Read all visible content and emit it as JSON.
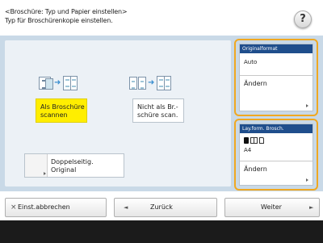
{
  "header": {
    "title": "<Broschüre: Typ und Papier einstellen>",
    "subtitle": "Typ für Broschürenkopie einstellen.",
    "help_label": "?"
  },
  "modes": [
    {
      "label_line1": "Als Broschüre",
      "label_line2": "scannen",
      "selected": true
    },
    {
      "label_line1": "Nicht als Br.-",
      "label_line2": "schüre scan.",
      "selected": false
    }
  ],
  "duplex": {
    "label_line1": "Doppelseitig.",
    "label_line2": "Original"
  },
  "original_format": {
    "title": "Originalformat",
    "value": "Auto",
    "change_label": "Ändern"
  },
  "layout_paper": {
    "title": "Lay.form. Brosch.",
    "paper": "A4",
    "change_label": "Ändern"
  },
  "bottom": {
    "cancel_icon": "×",
    "cancel_label": "Einst.abbrechen",
    "back_icon": "◄",
    "back_label": "Zurück",
    "next_label": "Weiter",
    "next_icon": "►"
  },
  "colors": {
    "accent": "#ffee00",
    "frame": "#f0a821",
    "title_bar": "#1f4e8c",
    "panel": "#c9d9e7"
  }
}
